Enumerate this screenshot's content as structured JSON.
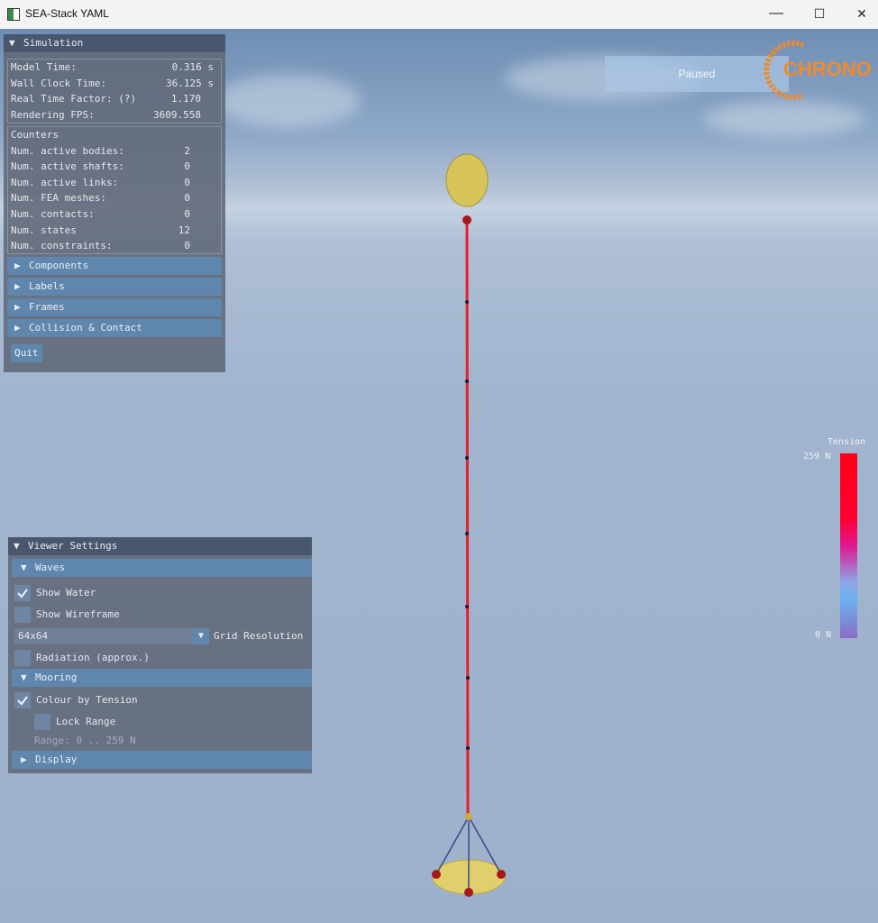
{
  "window": {
    "title": "SEA-Stack YAML",
    "minimize": "—",
    "maximize": "☐",
    "close": "✕"
  },
  "simulation": {
    "header": "Simulation",
    "stats": [
      {
        "label": "Model Time:",
        "value": "0.316 s"
      },
      {
        "label": "Wall Clock Time:",
        "value": "36.125 s"
      },
      {
        "label": "Real Time Factor: (?)",
        "value": "1.170"
      },
      {
        "label": "Rendering FPS:",
        "value": "3609.558"
      }
    ],
    "counters_title": "Counters",
    "counters": [
      {
        "label": "Num. active bodies:",
        "value": "2"
      },
      {
        "label": "Num. active shafts:",
        "value": "0"
      },
      {
        "label": "Num. active links:",
        "value": "0"
      },
      {
        "label": "Num. FEA meshes:",
        "value": "0"
      },
      {
        "label": "Num. contacts:",
        "value": "0"
      },
      {
        "label": "Num. states",
        "value": "12"
      },
      {
        "label": "Num. constraints:",
        "value": "0"
      }
    ],
    "sections": [
      "Components",
      "Labels",
      "Frames",
      "Collision & Contact"
    ],
    "quit": "Quit"
  },
  "viewer": {
    "header": "Viewer Settings",
    "waves_header": "Waves",
    "show_water": {
      "label": "Show Water",
      "checked": true
    },
    "show_wireframe": {
      "label": "Show Wireframe",
      "checked": false
    },
    "grid_resolution": {
      "value": "64x64",
      "label": "Grid Resolution"
    },
    "radiation": {
      "label": "Radiation (approx.)",
      "checked": false
    },
    "mooring_header": "Mooring",
    "colour_by_tension": {
      "label": "Colour by Tension",
      "checked": true
    },
    "lock_range": {
      "label": "Lock Range",
      "checked": false
    },
    "range_text": "Range: 0 .. 259 N",
    "display_header": "Display"
  },
  "status": {
    "paused": "Paused"
  },
  "logo": {
    "text": "CHRONO"
  },
  "colorbar": {
    "title": "Tension",
    "max_label": "259 N",
    "min_label": "0 N"
  },
  "colors": {
    "cable": "#e8202a",
    "buoy": "#d6c45a",
    "accent": "#5f86ad",
    "logo": "#f08a2c"
  }
}
